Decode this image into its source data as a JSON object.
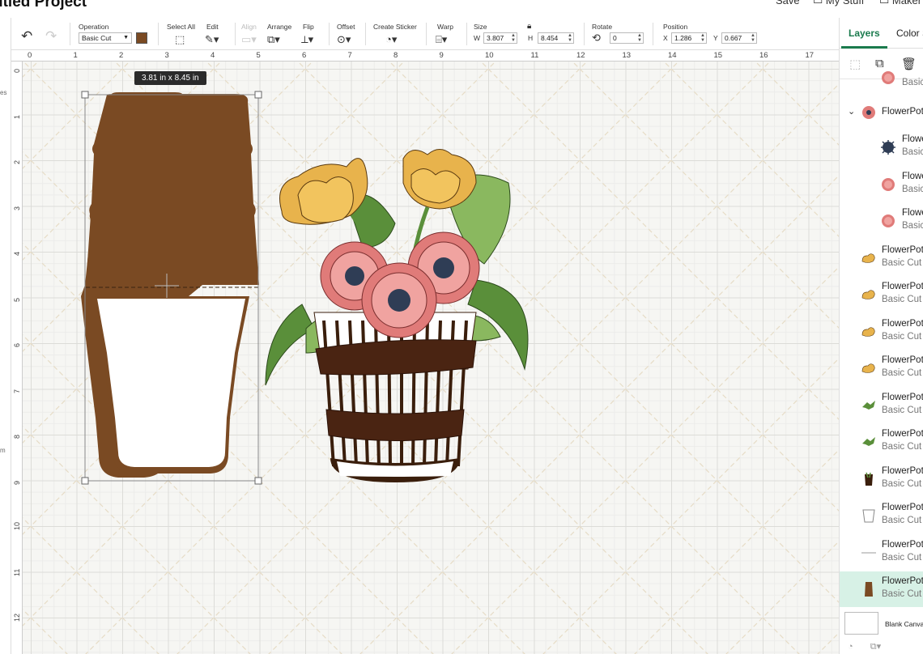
{
  "header": {
    "title": "titled Project",
    "right_items": [
      "Save",
      "My Stuff",
      "Maker"
    ]
  },
  "toolbar": {
    "undo_icon": "undo-icon",
    "redo_icon": "redo-icon",
    "operation": {
      "label": "Operation",
      "value": "Basic Cut",
      "color": "#7a4a23"
    },
    "select_all": "Select All",
    "edit": "Edit",
    "align": "Align",
    "arrange": "Arrange",
    "flip": "Flip",
    "offset": "Offset",
    "create_sticker": "Create Sticker",
    "warp": "Warp",
    "size": {
      "label": "Size",
      "w_label": "W",
      "w": "3.807",
      "h_label": "H",
      "h": "8.454"
    },
    "rotate": {
      "label": "Rotate",
      "value": "0"
    },
    "position": {
      "label": "Position",
      "x_label": "X",
      "x": "1.286",
      "y_label": "Y",
      "y": "0.667"
    }
  },
  "rulers": {
    "top": [
      "0",
      "1",
      "2",
      "3",
      "4",
      "5",
      "6",
      "7",
      "8",
      "9",
      "10",
      "11",
      "12",
      "13",
      "14",
      "15",
      "16",
      "17"
    ],
    "left": [
      "0",
      "1",
      "2",
      "3",
      "4",
      "5",
      "6",
      "7",
      "8",
      "9",
      "10",
      "11",
      "12"
    ]
  },
  "leftstrip": {
    "labels": [
      "es",
      "m"
    ]
  },
  "canvas": {
    "size_tag": "3.81  in x 8.45  in"
  },
  "panel": {
    "tabs": [
      "Layers",
      "Color S"
    ],
    "layers": [
      {
        "name": "",
        "op": "Basic",
        "kind": "flower-pink",
        "child": true,
        "partial_top": true
      },
      {
        "name": "FlowerPot",
        "group": true,
        "kind": "flower-group"
      },
      {
        "name": "Flowe",
        "op": "Basic",
        "kind": "flower-center",
        "child": true
      },
      {
        "name": "Flowe",
        "op": "Basic",
        "kind": "flower-pink",
        "child": true
      },
      {
        "name": "Flowe",
        "op": "Basic",
        "kind": "flower-pink",
        "child": true
      },
      {
        "name": "FlowerPot",
        "op": "Basic Cut",
        "kind": "flower-yellow"
      },
      {
        "name": "FlowerPot",
        "op": "Basic Cut",
        "kind": "flower-yellow"
      },
      {
        "name": "FlowerPot",
        "op": "Basic Cut",
        "kind": "flower-yellow"
      },
      {
        "name": "FlowerPot",
        "op": "Basic Cut",
        "kind": "flower-yellow"
      },
      {
        "name": "FlowerPot",
        "op": "Basic Cut",
        "kind": "leaf"
      },
      {
        "name": "FlowerPot",
        "op": "Basic Cut",
        "kind": "leaf"
      },
      {
        "name": "FlowerPot",
        "op": "Basic Cut",
        "kind": "basket"
      },
      {
        "name": "FlowerPot",
        "op": "Basic Cut",
        "kind": "pot-outline"
      },
      {
        "name": "FlowerPot",
        "op": "Basic Cut",
        "kind": "line"
      },
      {
        "name": "FlowerPot",
        "op": "Basic Cut",
        "kind": "pot-brown",
        "selected": true
      }
    ],
    "blank_canvas": "Blank Canvas"
  }
}
